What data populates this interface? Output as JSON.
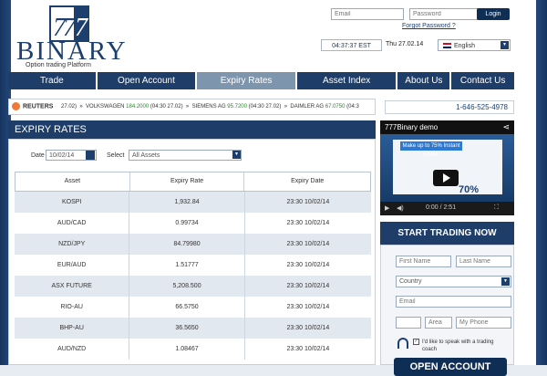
{
  "brand": {
    "name": "BINARY",
    "tagline": "Option trading Platform",
    "logo_digits": "777"
  },
  "login": {
    "email_placeholder": "Email",
    "password_placeholder": "Password",
    "button": "Login",
    "forgot": "Forgot Password ?"
  },
  "status": {
    "time": "04:37:37 EST",
    "date": "Thu 27.02.14",
    "language": "English"
  },
  "nav": [
    "Trade",
    "Open Account",
    "Expiry Rates",
    "Asset Index",
    "About Us",
    "Contact Us"
  ],
  "nav_active": "Expiry Rates",
  "ticker": {
    "source": "REUTERS",
    "lead": "27.02)",
    "items": [
      {
        "name": "VOLKSWAGEN",
        "value": "184.2000",
        "time": "(04:30 27.02)"
      },
      {
        "name": "SIEMENS AG",
        "value": "95.7200",
        "time": "(04:30 27.02)"
      },
      {
        "name": "DAIMLER AG",
        "value": "67.0750",
        "time": "(04:3"
      }
    ]
  },
  "phone": "1-646-525-4978",
  "expiry": {
    "title": "EXPIRY RATES",
    "date_label": "Date",
    "date_value": "10/02/14",
    "select_label": "Select",
    "select_value": "All Assets",
    "columns": [
      "Asset",
      "Expiry Rate",
      "Expiry Date"
    ],
    "rows": [
      [
        "KOSPI",
        "1,932.84",
        "23:30 10/02/14"
      ],
      [
        "AUD/CAD",
        "0.99734",
        "23:30 10/02/14"
      ],
      [
        "NZD/JPY",
        "84.79980",
        "23:30 10/02/14"
      ],
      [
        "EUR/AUD",
        "1.51777",
        "23:30 10/02/14"
      ],
      [
        "ASX FUTURE",
        "5,208.500",
        "23:30 10/02/14"
      ],
      [
        "RIO-AU",
        "66.5750",
        "23:30 10/02/14"
      ],
      [
        "BHP-AU",
        "36.5650",
        "23:30 10/02/14"
      ],
      [
        "AUD/NZD",
        "1.08467",
        "23:30 10/02/14"
      ]
    ]
  },
  "video": {
    "title": "777Binary demo",
    "banner": "Make up to 75% Instant Profit!",
    "percent": "70%",
    "time": "0:00 / 2:51"
  },
  "start": {
    "title": "START TRADING NOW",
    "first_name": "First Name",
    "last_name": "Last Name",
    "country": "Country",
    "email": "Email",
    "area": "Area",
    "phone": "My Phone",
    "speak": "I'd like to speak with a trading coach",
    "open_button": "OPEN ACCOUNT"
  }
}
